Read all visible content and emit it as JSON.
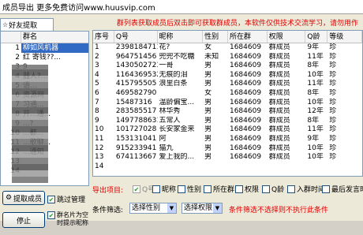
{
  "title_bar": {
    "text": "成员导出 更多免费访问www.huusvip.com"
  },
  "left_panel": {
    "tab_label": "好友提取",
    "group_list": {
      "header": "群名",
      "rows": [
        {
          "index": "1",
          "name": "柳如风机器"
        },
        {
          "index": "2",
          "name": "红 寄钱??..."
        },
        {
          "index": "3",
          "name": "9"
        },
        {
          "index": "4",
          "name": "器人?..."
        },
        {
          "index": "5",
          "name": "语..."
        },
        {
          "index": "6",
          "name": "资源网"
        },
        {
          "index": "7",
          "name": "习通..."
        },
        {
          "index": "8",
          "name": "开...通..."
        },
        {
          "index": "9",
          "name": "...?"
        },
        {
          "index": "10",
          "name": "...都..."
        },
        {
          "index": "11",
          "name": "...歌聊..."
        },
        {
          "index": "12",
          "name": "...通知"
        },
        {
          "index": "13",
          "name": ""
        },
        {
          "index": "14",
          "name": ""
        }
      ]
    },
    "extract_button": "提取成员",
    "skip_admin_label": "跳过管理",
    "stop_button": "停止",
    "group_tip_label": "群名片为空时提示昵称"
  },
  "notice": "群列表获取成员后双击即可获取群成员，本软件仅供技术交流学习，请勿用作",
  "member_table": {
    "columns": [
      "序号",
      "Q号",
      "昵称",
      "性别",
      "所在群",
      "权限",
      "Q龄",
      "等级"
    ],
    "rows": [
      [
        "1",
        "2398184711",
        "花?",
        "女",
        "1684609",
        "群成员",
        "9年",
        "珍"
      ],
      [
        "2",
        "964751456",
        "兜兜不吃糖",
        "未知",
        "1684609",
        "群成员",
        "11年",
        "珍"
      ],
      [
        "3",
        "1430502723",
        "一哥",
        "男",
        "1684609",
        "群成员",
        "8年",
        "珍"
      ],
      [
        "4",
        "1164369532",
        "无痕的泪",
        "男",
        "1684609",
        "群成员",
        "10年",
        "珍"
      ],
      [
        "5",
        "415795505",
        "浪里白条",
        "男",
        "1684609",
        "群成员",
        "11年",
        "珍"
      ],
      [
        "6",
        "469582790",
        "",
        "女",
        "1684609",
        "群成员",
        "8年",
        "珍"
      ],
      [
        "7",
        "15487316",
        "温龄偏宝...",
        "男",
        "1684609",
        "群成员",
        "10年",
        "珍"
      ],
      [
        "8",
        "283585517",
        "林华秀",
        "男",
        "1684609",
        "群成员",
        "12年",
        "珍"
      ],
      [
        "9",
        "1497788631",
        "五常人",
        "男",
        "1684609",
        "群成员",
        "8年",
        "珍"
      ],
      [
        "10",
        "101727028",
        "长安家金来",
        "男",
        "1684609",
        "群成员",
        "11年",
        "珍"
      ],
      [
        "11",
        "153131041",
        "阿",
        "男",
        "1684609",
        "群成员",
        "9年",
        "珍"
      ],
      [
        "12",
        "915233941",
        "猫九",
        "男",
        "1684609",
        "群成员",
        "10年",
        "珍"
      ],
      [
        "13",
        "674113667",
        "爱上我的...",
        "男",
        "1684609",
        "群成员",
        "10年",
        "珍"
      ],
      [
        "14",
        "",
        "",
        "",
        "",
        "",
        "",
        ""
      ]
    ]
  },
  "export": {
    "label": "导出项目:",
    "items": [
      {
        "label": "Q号",
        "checked": true,
        "disabled": true
      },
      {
        "label": "昵称",
        "checked": false
      },
      {
        "label": "性别",
        "checked": false
      },
      {
        "label": "所在群",
        "checked": false
      },
      {
        "label": "权限",
        "checked": false
      },
      {
        "label": "Q龄",
        "checked": false
      },
      {
        "label": "入群时间",
        "checked": false
      },
      {
        "label": "最后发言时",
        "checked": false
      }
    ]
  },
  "filter": {
    "label": "条件筛选:",
    "gender_select": "选择性别",
    "permission_select": "选择权限",
    "hint": "条件筛选不选择则不执行此条件"
  }
}
